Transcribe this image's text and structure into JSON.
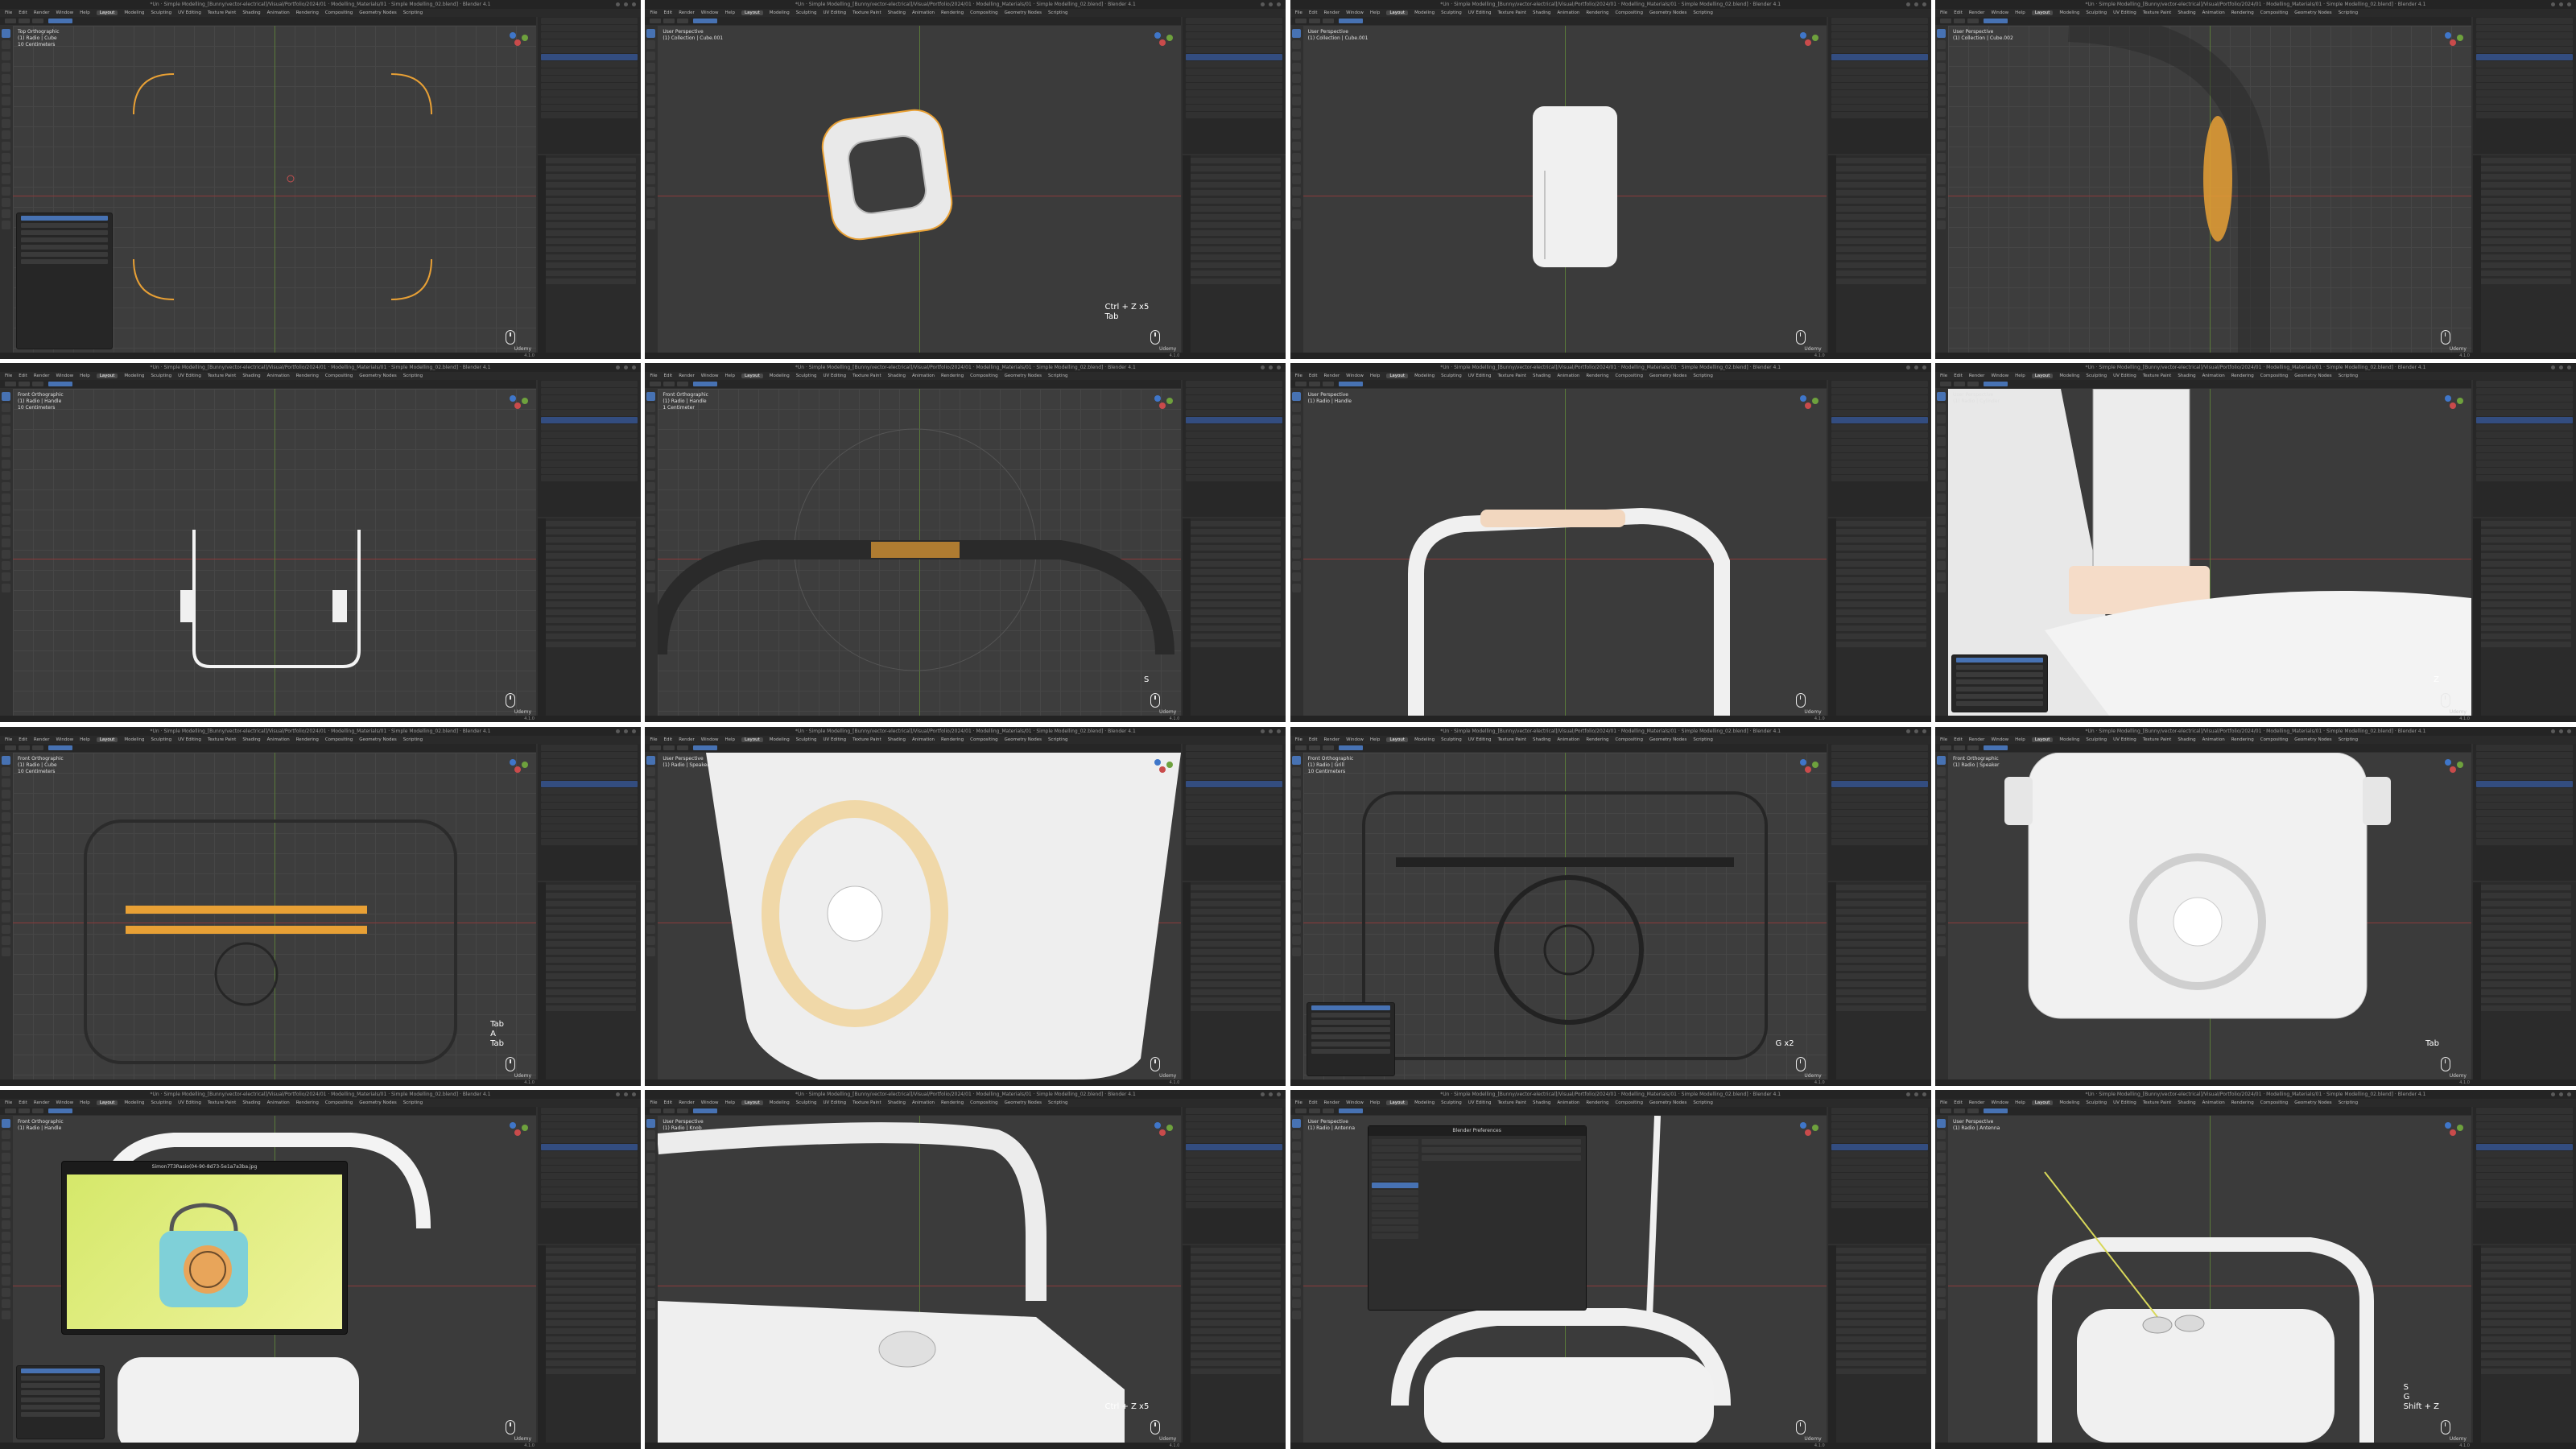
{
  "app": {
    "window_title": "*Un · Simple Modelling_[Bunny/vector-electrical]/Visual/Portfolio/2024/01 · Modelling_Materials/01 · Simple Modelling_02.blend] · Blender 4.1",
    "menu_items": [
      "File",
      "Edit",
      "Render",
      "Window",
      "Help"
    ],
    "workspaces": [
      "Layout",
      "Modeling",
      "Sculpting",
      "UV Editing",
      "Texture Paint",
      "Shading",
      "Animation",
      "Rendering",
      "Compositing",
      "Geometry Nodes",
      "Scripting"
    ],
    "active_workspace": "Layout",
    "status_version": "4.1.0",
    "brand": "Udemy"
  },
  "colors": {
    "viewport_bg": "#3d3d3d",
    "selection_orange": "#e8a035",
    "accent_blue": "#4772b3",
    "mesh_white": "#f2f2f2"
  },
  "tiles": [
    {
      "id": 1,
      "info": "Top Orthographic\n(1) Radio | Cube\n10 Centimeters",
      "shortcut": "",
      "content": "rounded-outline"
    },
    {
      "id": 2,
      "info": "User Perspective\n(1) Collection | Cube.001",
      "shortcut": "Ctrl + Z x5\nTab",
      "content": "rounded-frame"
    },
    {
      "id": 3,
      "info": "User Perspective\n(1) Collection | Cube.001",
      "shortcut": "",
      "content": "side-body"
    },
    {
      "id": 4,
      "info": "User Perspective\n(1) Collection | Cube.002",
      "shortcut": "",
      "content": "cylinder-wire"
    },
    {
      "id": 5,
      "info": "Front Orthographic\n(1) Radio | Handle\n10 Centimeters",
      "shortcut": "",
      "content": "handle-front"
    },
    {
      "id": 6,
      "info": "Front Orthographic\n(1) Radio | Handle\n1 Centimeter",
      "shortcut": "S",
      "content": "handle-loop"
    },
    {
      "id": 7,
      "info": "User Perspective\n(1) Radio | Handle",
      "shortcut": "",
      "content": "handle-3d"
    },
    {
      "id": 8,
      "info": "User Perspective\n(1) Radio | Cylinder",
      "shortcut": "Z",
      "content": "antenna-closeup"
    },
    {
      "id": 9,
      "info": "Front Orthographic\n(1) Radio | Cube\n10 Centimeters",
      "shortcut": "Tab\nA\nTab",
      "content": "front-wire"
    },
    {
      "id": 10,
      "info": "User Perspective\n(1) Radio | Speaker",
      "shortcut": "",
      "content": "speaker-closeup"
    },
    {
      "id": 11,
      "info": "Front Orthographic\n(1) Radio | Grill\n10 Centimeters",
      "shortcut": "G x2",
      "content": "grill-wire"
    },
    {
      "id": 12,
      "info": "Front Orthographic\n(1) Radio | Speaker",
      "shortcut": "Tab",
      "content": "radio-front"
    },
    {
      "id": 13,
      "info": "Front Orthographic\n(1) Radio | Handle",
      "shortcut": "",
      "content": "ref-image",
      "image_viewer_title": "Simon7T3Rasio(04-90-8d73-5e1a7a3ba.jpg"
    },
    {
      "id": 14,
      "info": "User Perspective\n(1) Radio | Knob",
      "shortcut": "Ctrl + Z x5",
      "content": "top-view"
    },
    {
      "id": 15,
      "info": "User Perspective\n(1) Radio | Antenna",
      "shortcut": "",
      "content": "preferences",
      "preferences_title": "Blender Preferences"
    },
    {
      "id": 16,
      "info": "User Perspective\n(1) Radio | Antenna",
      "shortcut": "S\nG\nShift + Z",
      "content": "radio-antenna"
    }
  ]
}
